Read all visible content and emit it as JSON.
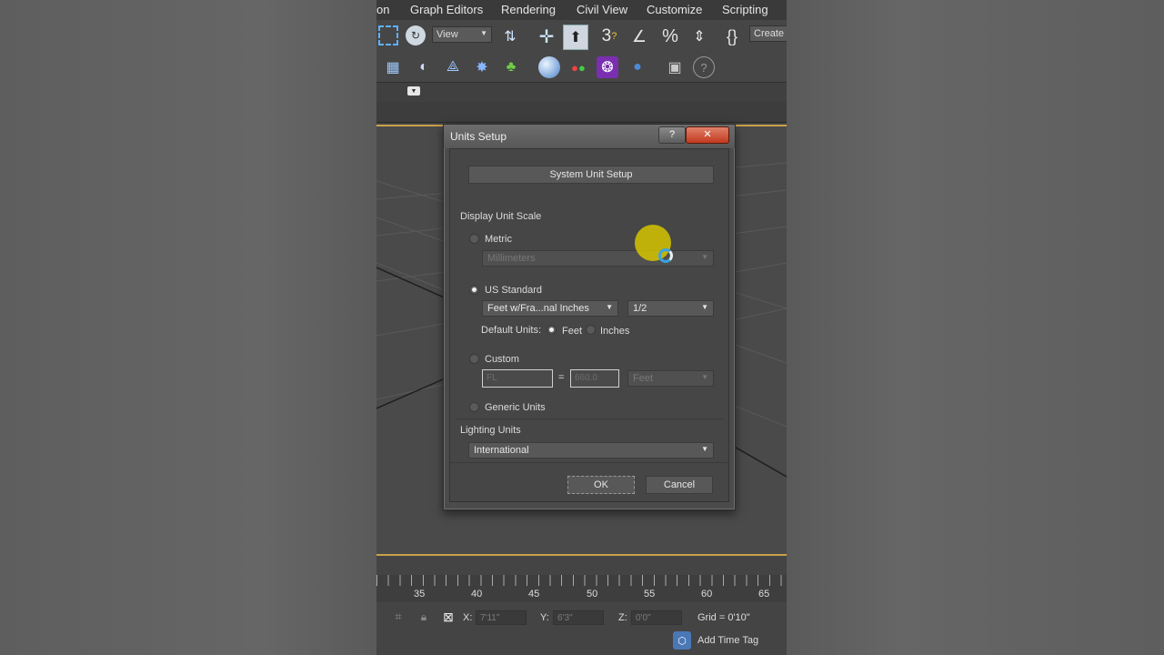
{
  "menu": [
    "on",
    "Graph Editors",
    "Rendering",
    "Civil View",
    "Customize",
    "Scripting"
  ],
  "toolbar": {
    "view_dropdown": "View",
    "create_label": "Create"
  },
  "dialog": {
    "title": "Units Setup",
    "help_glyph": "?",
    "close_glyph": "✕",
    "system_unit_button": "System Unit Setup",
    "display_unit_scale_label": "Display Unit Scale",
    "metric_label": "Metric",
    "metric_value": "Millimeters",
    "us_standard_label": "US Standard",
    "us_unit_value": "Feet w/Fra...nal Inches",
    "us_fraction_value": "1/2",
    "default_units_label": "Default Units:",
    "default_feet_label": "Feet",
    "default_inches_label": "Inches",
    "custom_label": "Custom",
    "custom_name_value": "FL",
    "custom_equals": "=",
    "custom_amount_value": "660.0",
    "custom_unit_value": "Feet",
    "generic_label": "Generic Units",
    "lighting_units_label": "Lighting Units",
    "lighting_value": "International",
    "ok_label": "OK",
    "cancel_label": "Cancel",
    "selected_scale": "US Standard",
    "selected_default_unit": "Feet"
  },
  "timeline": {
    "numbers": [
      "35",
      "40",
      "45",
      "50",
      "55",
      "60",
      "65"
    ]
  },
  "status": {
    "x_label": "X:",
    "x_value": "7'11\"",
    "y_label": "Y:",
    "y_value": "6'3\"",
    "z_label": "Z:",
    "z_value": "0'0\"",
    "grid": "Grid = 0'10\"",
    "time_tag": "Add Time Tag"
  },
  "colors": {
    "accent_border": "#c9a24a",
    "cursor_highlight": "#d6c400"
  }
}
